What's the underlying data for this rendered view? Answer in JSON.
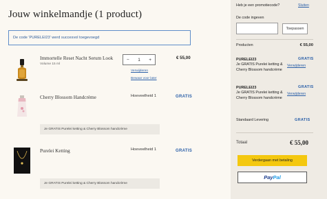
{
  "cart": {
    "title": "Jouw winkelmandje (1 product)",
    "alert": "De code 'PURELEI23' werd succesvol toegevoegd"
  },
  "items": [
    {
      "name": "Immortelle Reset Nacht Serum Look",
      "volume": "Volume 15 ml",
      "quantity": "1",
      "minus": "−",
      "plus": "+",
      "price": "€ 55,00",
      "remove": "Verwijderen",
      "save_later": "Bewaar voor later"
    },
    {
      "name": "Cherry Blossom Handcrème",
      "quantity": "Hoeveelheid 1",
      "price": "GRATIS",
      "note": "Je GRATIS Purelei ketting & Cherry Blossom handcrème"
    },
    {
      "name": "Purelei Ketting",
      "quantity": "Hoeveelheid 1",
      "price": "GRATIS",
      "note": "Je GRATIS Purelei ketting & Cherry Blossom handcrème"
    }
  ],
  "sidebar": {
    "promo_question": "Heb je een promotiecode?",
    "close": "Sluiten",
    "code_label": "De code ingeven",
    "code_value": "",
    "apply": "Toepassen",
    "products_label": "Producten",
    "products_value": "€ 55,00",
    "promo1_code": "PURELEI23",
    "promo1_desc": "Je GRATIS Purelei ketting & Cherry Blossom handcrème",
    "promo1_value": "GRATIS",
    "promo1_remove": "Verwijderen",
    "promo2_code": "PURELEI23",
    "promo2_desc": "Je GRATIS Purelei ketting & Cherry Blossom handcrème",
    "promo2_value": "GRATIS",
    "promo2_remove": "Verwijderen",
    "shipping_label": "Standaard Levering",
    "shipping_value": "GRATIS",
    "total_label": "Totaal",
    "total_value": "€ 55,00",
    "checkout": "Verdergaan met betaling",
    "paypal_part1": "Pay",
    "paypal_part2": "Pal"
  },
  "colors": {
    "accent_blue": "#2a5fa8",
    "checkout_yellow": "#f4c80f",
    "sidebar_bg": "#efebe4",
    "page_bg": "#fbf8f2"
  }
}
